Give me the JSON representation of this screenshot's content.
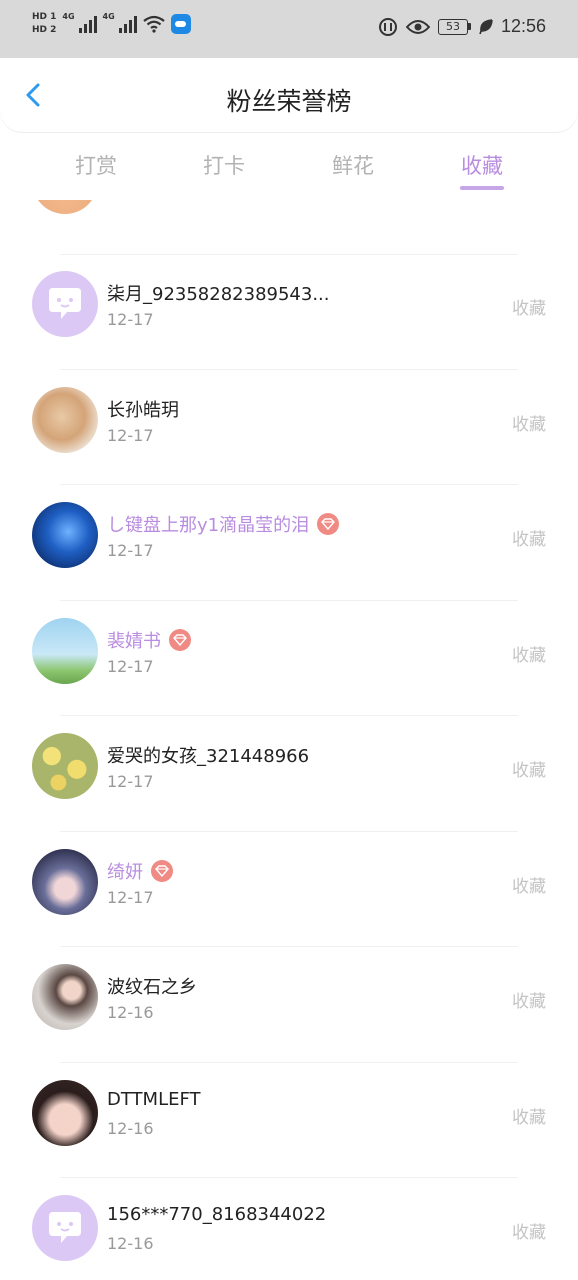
{
  "status_bar": {
    "sim1": "HD 1",
    "sim2": "HD 2",
    "net1": "4G",
    "net2": "4G",
    "battery": "53",
    "time": "12:56"
  },
  "header": {
    "title": "粉丝荣誉榜"
  },
  "tabs": [
    {
      "label": "打赏",
      "active": false
    },
    {
      "label": "打卡",
      "active": false
    },
    {
      "label": "鲜花",
      "active": false
    },
    {
      "label": "收藏",
      "active": true
    }
  ],
  "colors": {
    "accent": "#b98de0",
    "vip_badge": "#f08a84",
    "muted": "#999999"
  },
  "rows": [
    {
      "name": "柒月_92358282389543...",
      "date": "12-17",
      "action": "收藏",
      "vip": false,
      "avatar": "default-chat-avatar"
    },
    {
      "name": "长孙皓玥",
      "date": "12-17",
      "action": "收藏",
      "vip": false,
      "avatar": "dog-photo-avatar"
    },
    {
      "name": "し键盘上那у1滴晶莹的泪",
      "date": "12-17",
      "action": "收藏",
      "vip": true,
      "avatar": "butterfly-avatar"
    },
    {
      "name": "裴婧书",
      "date": "12-17",
      "action": "收藏",
      "vip": true,
      "avatar": "anime-couple-avatar"
    },
    {
      "name": "爱哭的女孩_321448966",
      "date": "12-17",
      "action": "收藏",
      "vip": false,
      "avatar": "flowers-avatar"
    },
    {
      "name": "绮妍",
      "date": "12-17",
      "action": "收藏",
      "vip": true,
      "avatar": "anime-girl-avatar"
    },
    {
      "name": "波纹石之乡",
      "date": "12-16",
      "action": "收藏",
      "vip": false,
      "avatar": "woman-photo-avatar"
    },
    {
      "name": "DTTMLEFT",
      "date": "12-16",
      "action": "收藏",
      "vip": false,
      "avatar": "girl-face-avatar"
    },
    {
      "name": "156***770_8168344022",
      "date": "12-16",
      "action": "收藏",
      "vip": false,
      "avatar": "default-chat-avatar"
    }
  ]
}
